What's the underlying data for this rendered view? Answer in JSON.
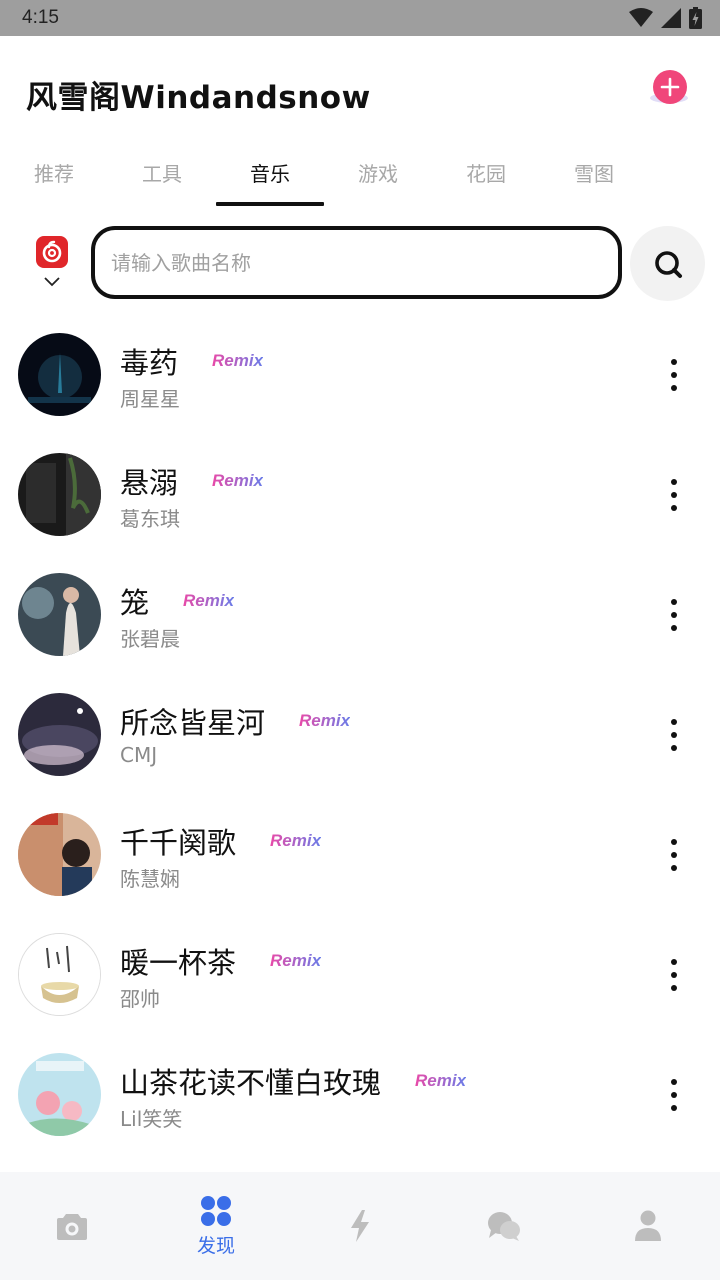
{
  "status_bar": {
    "time": "4:15"
  },
  "header": {
    "title": "风雪阁Windandsnow"
  },
  "tabs": [
    {
      "label": "推荐"
    },
    {
      "label": "工具"
    },
    {
      "label": "音乐"
    },
    {
      "label": "游戏"
    },
    {
      "label": "花园"
    },
    {
      "label": "雪图"
    }
  ],
  "active_tab": "音乐",
  "search": {
    "placeholder": "请输入歌曲名称",
    "value": ""
  },
  "badge_label": "Remix",
  "songs": [
    {
      "title": "毒药",
      "artist": "周星星"
    },
    {
      "title": "悬溺",
      "artist": "葛东琪"
    },
    {
      "title": "笼",
      "artist": "张碧晨"
    },
    {
      "title": "所念皆星河",
      "artist": "CMJ"
    },
    {
      "title": "千千阕歌",
      "artist": "陈慧娴"
    },
    {
      "title": "暖一杯茶",
      "artist": "邵帅"
    },
    {
      "title": "山茶花读不懂白玫瑰",
      "artist": "Lil笑笑"
    }
  ],
  "bottom_nav": {
    "items": [
      {
        "icon": "camera-icon",
        "label": ""
      },
      {
        "icon": "discover-grid-icon",
        "label": "发现"
      },
      {
        "icon": "lightning-icon",
        "label": ""
      },
      {
        "icon": "chat-bubbles-icon",
        "label": ""
      },
      {
        "icon": "person-icon",
        "label": ""
      }
    ],
    "active_index": 1
  },
  "colors": {
    "accent": "#3a6ee8",
    "add_button": "#f0467a",
    "music_source_red": "#e0262a"
  }
}
